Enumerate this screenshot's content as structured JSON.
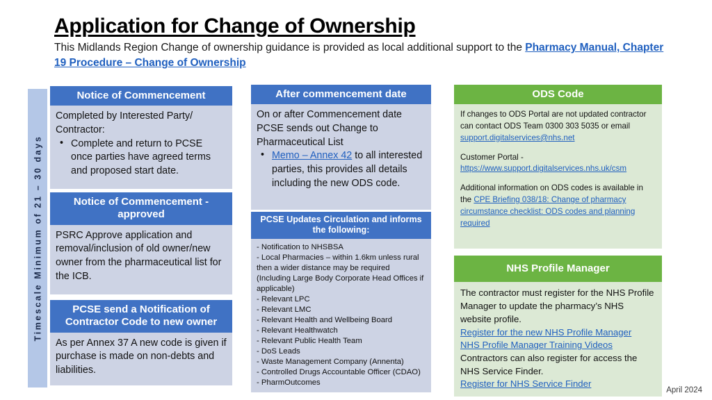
{
  "header": {
    "title": "Application for Change of Ownership",
    "subtitle_pre": "This Midlands Region Change of ownership guidance is provided as local additional support to the ",
    "subtitle_link": "Pharmacy Manual, Chapter 19 Procedure – Change of Ownership"
  },
  "timescale": {
    "label": "Timescale Minimum of 21 – 30 days"
  },
  "column1": {
    "card_a": {
      "heading": "Notice of Commencement",
      "line1": "Completed by Interested Party/",
      "line2": "Contractor:",
      "bullet1": "Complete and return to PCSE once parties have agreed terms and proposed start date."
    },
    "card_b": {
      "heading": "Notice of Commencement - approved",
      "body": "PSRC Approve application and removal/inclusion of old owner/new owner from the pharmaceutical list for the ICB."
    },
    "card_c": {
      "heading": "PCSE send a Notification of Contractor Code to new owner",
      "body": "As per Annex 37 A new code is given if purchase is made on non-debts and liabilities."
    }
  },
  "column2": {
    "card_a": {
      "heading": "After commencement date",
      "line1": "On or after Commencement date PCSE sends out Change to Pharmaceutical List",
      "bullet_link": "Memo – Annex 42",
      "bullet_rest": " to all interested parties, this provides all details including the new ODS code."
    },
    "card_b": {
      "heading": "PCSE Updates Circulation and informs the following:",
      "items": [
        "- Notification to NHSBSA",
        "- Local Pharmacies – within 1.6km unless rural then a wider distance may be required (Including Large Body Corporate Head Offices if applicable)",
        "- Relevant LPC",
        "- Relevant LMC",
        "- Relevant Health and Wellbeing Board",
        "- Relevant Healthwatch",
        "- Relevant Public Health Team",
        "- DoS Leads",
        "- Waste Management Company (Annenta)",
        "- Controlled Drugs Accountable Officer (CDAO)",
        "- PharmOutcomes"
      ]
    }
  },
  "column3": {
    "card_a": {
      "heading": "ODS Code",
      "para1": "If changes to ODS Portal are not updated contractor can contact ODS Team 0300 303 5035 or email ",
      "email": "support.digitalservices@nhs.net",
      "para2_label": "Customer Portal -",
      "portal_url": "https://www.support.digitalservices.nhs.uk/csm",
      "para3_pre": "Additional information on ODS codes is available in the ",
      "para3_link": "CPE Briefing 038/18: Change of pharmacy circumstance checklist: ODS codes and planning required"
    },
    "card_b": {
      "heading": "NHS Profile Manager",
      "para1": "The contractor must register for the NHS Profile Manager to update the pharmacy’s NHS website profile.",
      "link1": "Register for the new NHS Profile Manager",
      "link2": "NHS Profile Manager Training Videos",
      "para2": "Contractors can also register for access the NHS Service Finder.",
      "link3": "Register for NHS Service Finder"
    }
  },
  "footer": {
    "date": "April 2024"
  },
  "colors": {
    "header_blue": "#4072C4",
    "header_green": "#6CB443",
    "body_blue": "#CDD3E4",
    "body_green": "#DCE9D5",
    "timescale_bar": "#B4C7E7",
    "link_blue": "#1F5FBF"
  }
}
